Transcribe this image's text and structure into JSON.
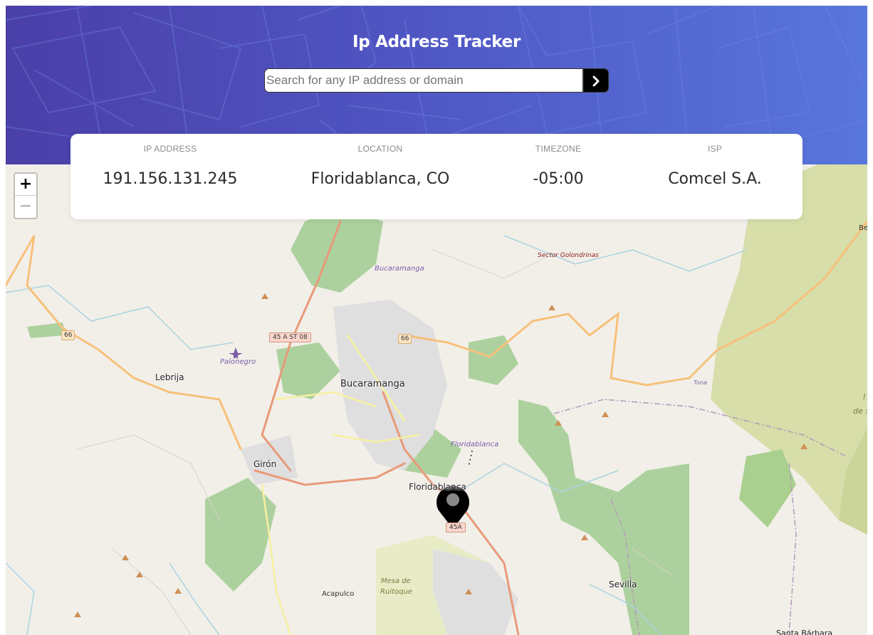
{
  "header": {
    "title": "Ip Address Tracker",
    "search_placeholder": "Search for any IP address or domain",
    "search_value": ""
  },
  "info": {
    "ip_label": "IP ADDRESS",
    "ip_value": "191.156.131.245",
    "location_label": "LOCATION",
    "location_value": "Floridablanca, CO",
    "timezone_label": "TIMEZONE",
    "timezone_value": "-05:00",
    "isp_label": "ISP",
    "isp_value": "Comcel S.A."
  },
  "map": {
    "zoom_in": "+",
    "zoom_out": "−",
    "labels": {
      "bucaramanga": "Bucaramanga",
      "bucaramanga_area": "Bucaramanga",
      "floridablanca": "Floridablanca",
      "floridablanca_area": "Floridablanca",
      "giron": "Girón",
      "lebrija": "Lebrija",
      "palonegro": "Palonegro",
      "sevilla": "Sevilla",
      "acapulco": "Acapulco",
      "mesa": "Mesa de",
      "ruitoque": "Ruitoque",
      "golondrinas": "Sector Golondrinas",
      "santa_barbara": "Santa Bárbara",
      "tona": "Tona",
      "be": "Be",
      "de": "de :",
      "r1": "l",
      "road_66a": "66",
      "road_66b": "66",
      "road_45ast": "45 A ST 08",
      "road_45a": "45A"
    }
  }
}
